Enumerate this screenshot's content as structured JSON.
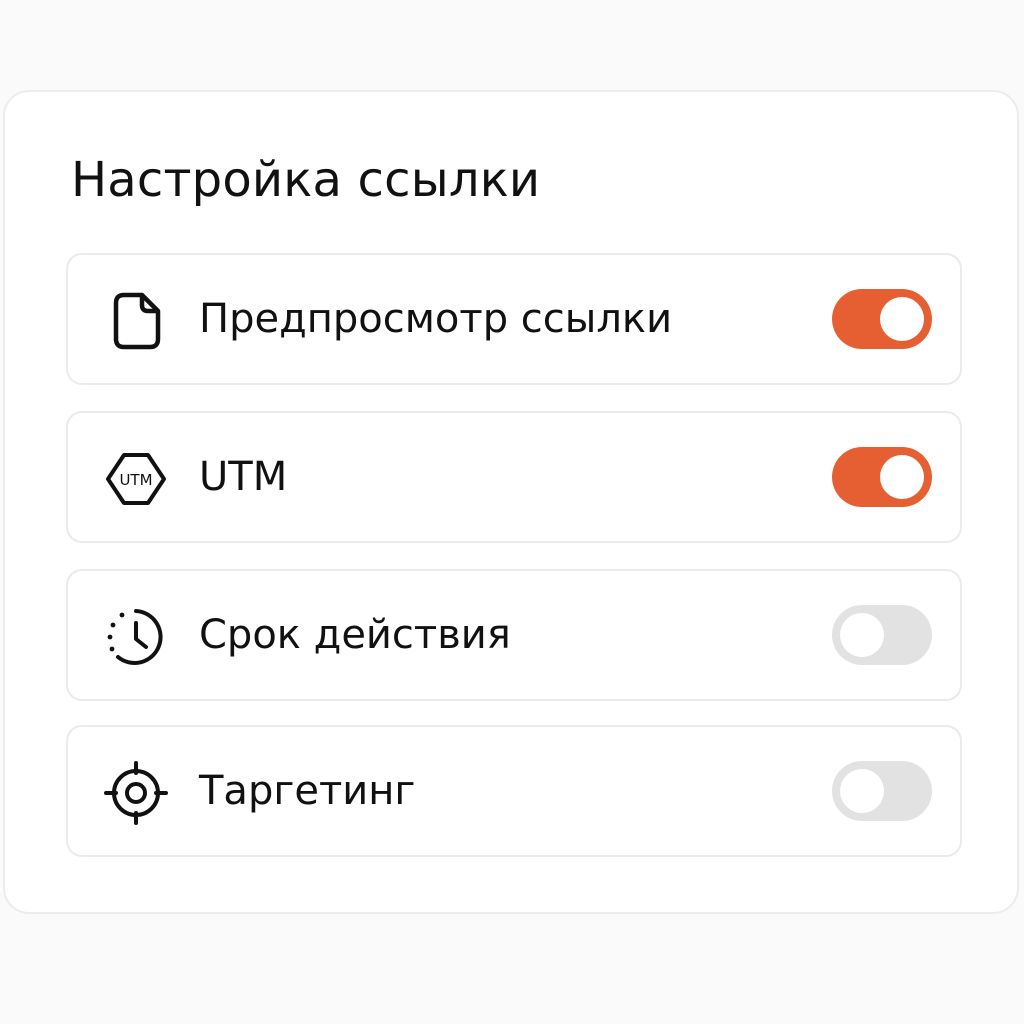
{
  "panel": {
    "title": "Настройка ссылки"
  },
  "settings": [
    {
      "label": "Предпросмотр ссылки",
      "icon": "document-icon",
      "enabled": true
    },
    {
      "label": "UTM",
      "icon": "utm-hexagon-icon",
      "icon_text": "UTM",
      "enabled": true
    },
    {
      "label": "Срок действия",
      "icon": "clock-icon",
      "enabled": false
    },
    {
      "label": "Таргетинг",
      "icon": "target-crosshair-icon",
      "enabled": false
    }
  ],
  "colors": {
    "toggle_on": "#e65f33",
    "toggle_off": "#e2e2e2"
  }
}
